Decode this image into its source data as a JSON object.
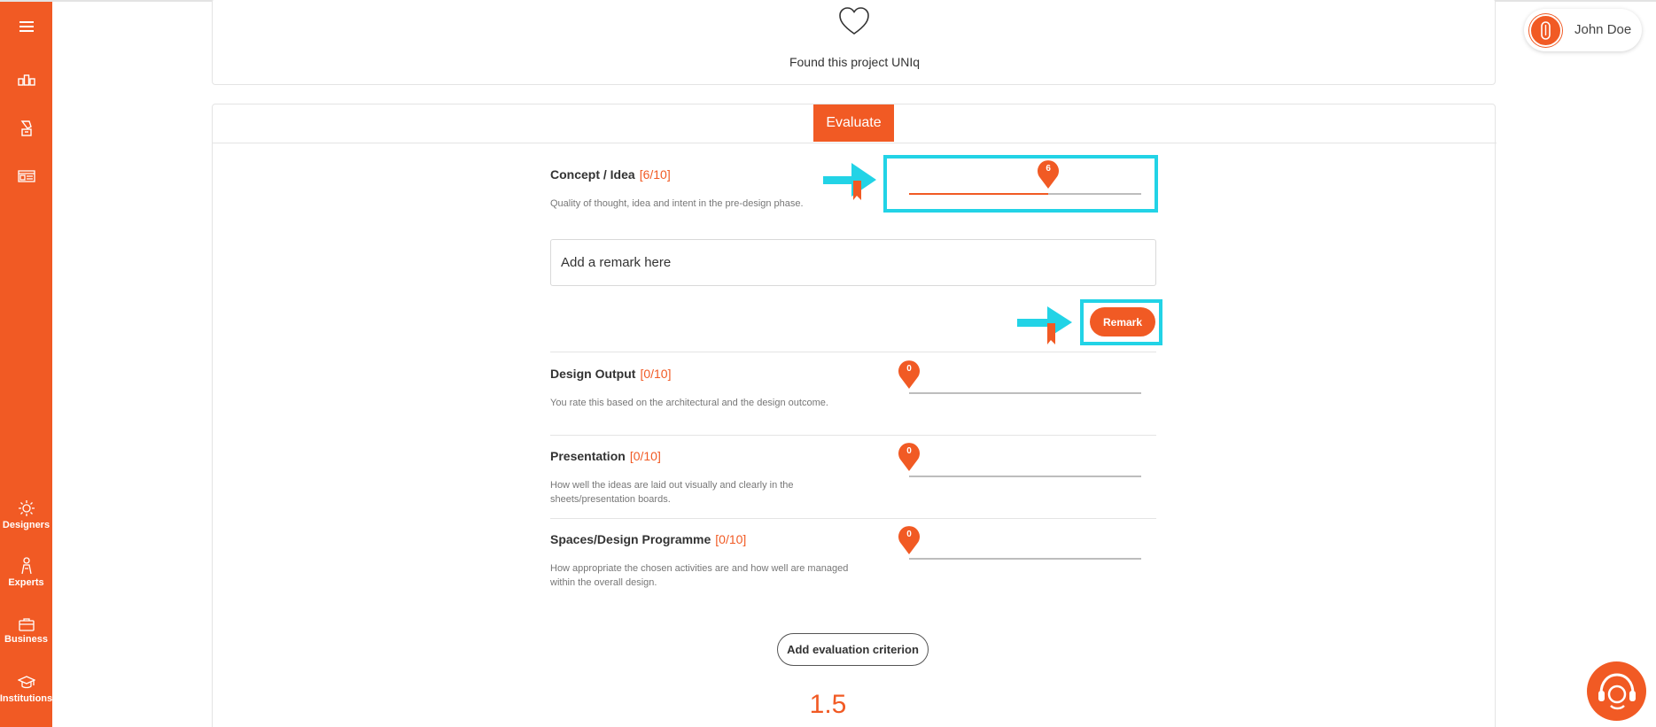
{
  "colors": {
    "accent": "#f15a24",
    "highlight": "#22d3e6",
    "divider": "#e4e4e4"
  },
  "sidebar": {
    "top_items": [
      {
        "icon": "menu-icon"
      },
      {
        "icon": "projects-icon"
      },
      {
        "icon": "competitions-icon"
      },
      {
        "icon": "feed-icon"
      }
    ],
    "bottom_items": [
      {
        "icon": "designers-icon",
        "label": "Designers"
      },
      {
        "icon": "experts-icon",
        "label": "Experts"
      },
      {
        "icon": "business-icon",
        "label": "Business"
      },
      {
        "icon": "institutions-icon",
        "label": "Institutions"
      }
    ]
  },
  "project": {
    "like_text": "Found this project UNIq"
  },
  "evaluate": {
    "tab_label": "Evaluate",
    "criteria": [
      {
        "title": "Concept / Idea",
        "score": "[6/10]",
        "description": "Quality of thought, idea and intent in the pre-design phase.",
        "value": 6,
        "max": 10
      },
      {
        "title": "Design Output",
        "score": "[0/10]",
        "description": "You rate this based on the architectural and the design outcome.",
        "value": 0,
        "max": 10
      },
      {
        "title": "Presentation",
        "score": "[0/10]",
        "description": "How well the ideas are laid out visually and clearly in the sheets/presentation boards.",
        "value": 0,
        "max": 10
      },
      {
        "title": "Spaces/Design Programme",
        "score": "[0/10]",
        "description": "How appropriate the chosen activities are and how well are managed within the overall design.",
        "value": 0,
        "max": 10
      }
    ],
    "remark_placeholder": "Add a remark here",
    "remark_button": "Remark",
    "add_criterion_button": "Add evaluation criterion",
    "total_score": "1.5"
  },
  "user": {
    "name": "John Doe"
  }
}
